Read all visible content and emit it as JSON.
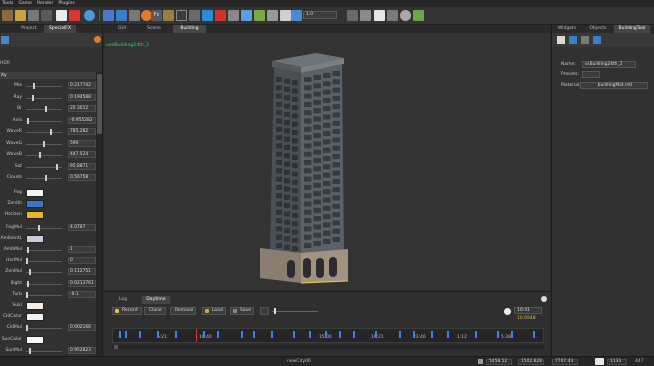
{
  "menu": [
    "Tools",
    "Game",
    "Render",
    "Plugins"
  ],
  "toolbar": {
    "layer_label": "1.0"
  },
  "left_panel": {
    "tabs": [
      "",
      "Project",
      "SpecialFX"
    ],
    "section_name": "HDR",
    "group_header": "ity",
    "properties": [
      {
        "label": "Mie",
        "value": "0.217742",
        "thumb": 0.22
      },
      {
        "label": "Ray",
        "value": "0.194588",
        "thumb": 0.19
      },
      {
        "label": "Br",
        "value": "20.3012",
        "thumb": 0.55
      },
      {
        "label": "Axis",
        "value": "-0.955282",
        "thumb": 0.02
      },
      {
        "label": "WaveR",
        "value": "785.282",
        "thumb": 0.7
      },
      {
        "label": "WaveG",
        "value": "590",
        "thumb": 0.5
      },
      {
        "label": "WaveB",
        "value": "447.524",
        "thumb": 0.37
      },
      {
        "label": "Sat",
        "value": "95.8871",
        "thumb": 0.88
      },
      {
        "label": "Clouds",
        "value": "0.56758",
        "thumb": 0.57
      }
    ],
    "colors": [
      {
        "label": "Fog",
        "color": "#f4f4f4"
      },
      {
        "label": "Zenith",
        "color": "#3f74c8"
      },
      {
        "label": "Horizon",
        "color": "#e8b52a"
      }
    ],
    "properties2": [
      {
        "label": "FogMul",
        "value": "4.0787",
        "thumb": 0.35
      },
      {
        "label": "AmbientL",
        "color": "#c8cde0"
      },
      {
        "label": "AmbMul",
        "value": "1",
        "thumb": 0.02
      },
      {
        "label": "HorMul",
        "value": "0",
        "thumb": 0.0
      },
      {
        "label": "ZenMul",
        "value": "0.112751",
        "thumb": 0.1
      },
      {
        "label": "Ilight",
        "value": "0.0213761",
        "thumb": 0.02
      },
      {
        "label": "Turb",
        "value": "-0.1",
        "thumb": 0.0
      },
      {
        "label": "Suki",
        "color": "#f6ece4"
      },
      {
        "label": "CldColor",
        "color": "#f1f1f1"
      },
      {
        "label": "CldMul",
        "value": "0.002166",
        "thumb": 0.0
      },
      {
        "label": "SunColor",
        "color": "#f6f6f6"
      },
      {
        "label": "SunMul",
        "value": "0.952823",
        "thumb": 0.1
      },
      {
        "label": "pRadius",
        "value": "",
        "thumb": 0.0
      }
    ]
  },
  "view_tabs": [
    "GUI",
    "Scene",
    "Building"
  ],
  "viewport": {
    "caption": "uedBuilding24th_2"
  },
  "dock": {
    "tabs": [
      "Log",
      "Daytime"
    ],
    "buttons": [
      "Record",
      "Clone",
      "Remove",
      "Load",
      "Save"
    ],
    "time_value": "10:41",
    "time_sub": "10.6948",
    "timeline_labels": [
      "6:21",
      "10:40",
      "15:00",
      "19:21",
      "23:40",
      "1:12",
      "5:38"
    ]
  },
  "right_panel": {
    "tabs": [
      "Widgets",
      "Objects",
      "BuildingTool"
    ],
    "name_label": "Name:",
    "name_value": "ssBuilding24th_2",
    "presets_label": "Presets:",
    "material_label": "Material:",
    "material_value": "buildingMat.mtl"
  },
  "statusbar": {
    "center": "newCity06",
    "coords": [
      "5458.52",
      "1502.828",
      "7707.43"
    ],
    "right": [
      "1133",
      "447"
    ]
  }
}
